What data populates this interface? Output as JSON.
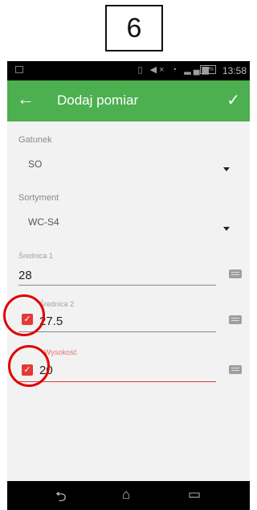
{
  "step": {
    "number": "6"
  },
  "status_bar": {
    "battery": "57%",
    "time": "13:58"
  },
  "app_bar": {
    "title": "Dodaj pomiar"
  },
  "gatunek": {
    "label": "Gatunek",
    "value": "SO"
  },
  "sortyment": {
    "label": "Sortyment",
    "value": "WC-S4"
  },
  "srednica1": {
    "label": "Średnica 1",
    "value": "28"
  },
  "srednica2": {
    "label": "Średnica 2",
    "value": "27.5",
    "checked": true
  },
  "wysokosc": {
    "label": "Wysokość",
    "value": "20",
    "checked": true
  },
  "colors": {
    "accent": "#4caf50",
    "error": "#e53935",
    "highlight_circle": "#e00000"
  },
  "icons": [
    "back-arrow-icon",
    "check-icon",
    "keyboard-icon",
    "checkbox-checked-icon",
    "nav-back-icon",
    "nav-home-icon",
    "nav-recent-icon"
  ]
}
